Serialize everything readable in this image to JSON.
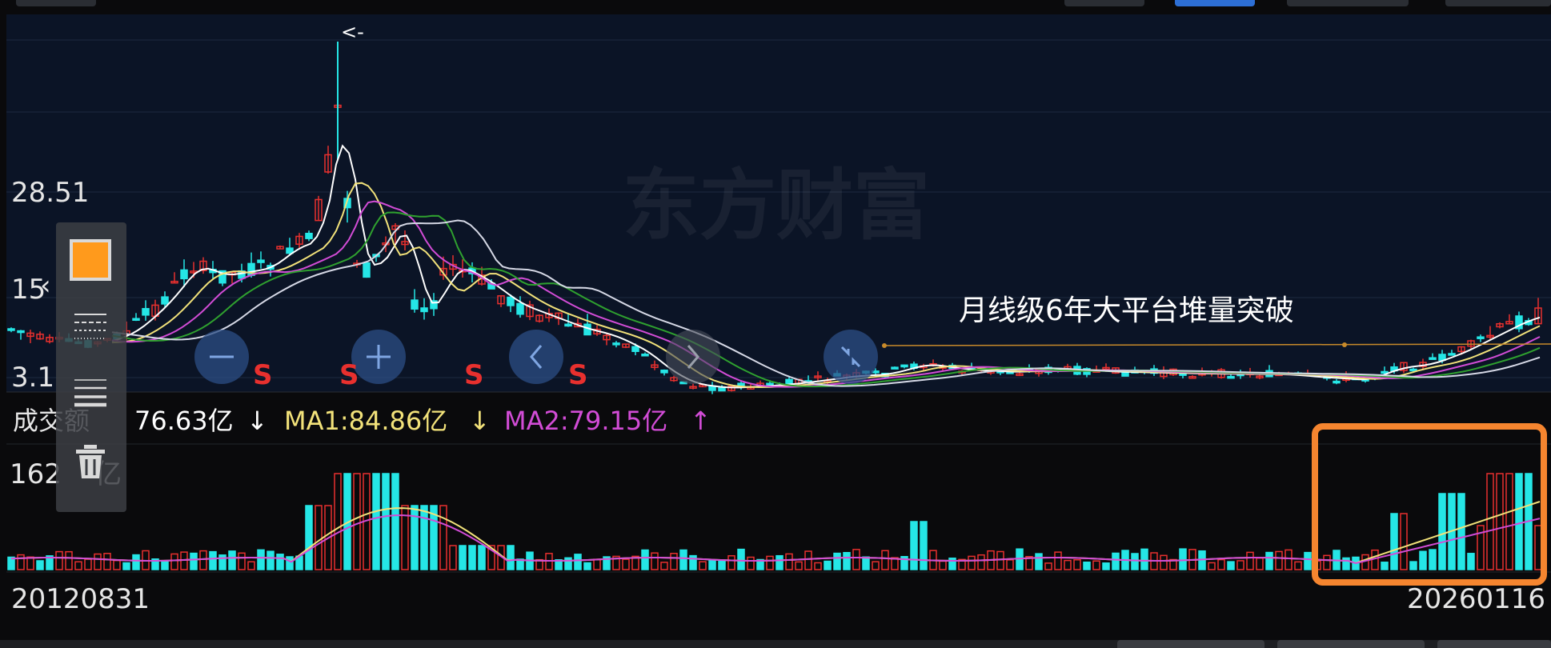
{
  "chart_data": {
    "type": "candlestick",
    "watermark": "东方财富",
    "price_panel": {
      "y_tick_labels": [
        "28.51",
        "15",
        "3.1"
      ],
      "annotation": "月线级6年大平台堆量突破",
      "signal_marks": [
        "S",
        "S",
        "S",
        "S"
      ],
      "ma_series_colors": [
        "#ffffff",
        "#f2e27a",
        "#d24cd6",
        "#2fa12f",
        "#d6d9e6"
      ]
    },
    "volume_panel": {
      "label": "成交额",
      "value": "76.63亿",
      "value_arrow": "↓",
      "ma1_label": "MA1:84.86亿",
      "ma1_arrow": "↓",
      "ma2_label": "MA2:79.15亿",
      "ma2_arrow": "↑",
      "y_top_label": "162",
      "y_top_unit": "亿"
    },
    "x_axis": {
      "start": "20120831",
      "end": "20260116"
    }
  },
  "colors": {
    "up": "#e8302e",
    "down": "#25e6e6",
    "highlight_box": "#f5852f",
    "ma1": "#f2e27a",
    "ma2": "#d24cd6",
    "plateau_line": "#c88a2a"
  },
  "toolbar": {
    "color_icon": "orange-square-icon",
    "icons": [
      "line-style-icon",
      "line-weight-icon",
      "trash-icon"
    ]
  },
  "nav_buttons": [
    "zoom-out-icon",
    "zoom-in-icon",
    "pan-left-icon",
    "pan-right-icon",
    "fit-icon"
  ]
}
